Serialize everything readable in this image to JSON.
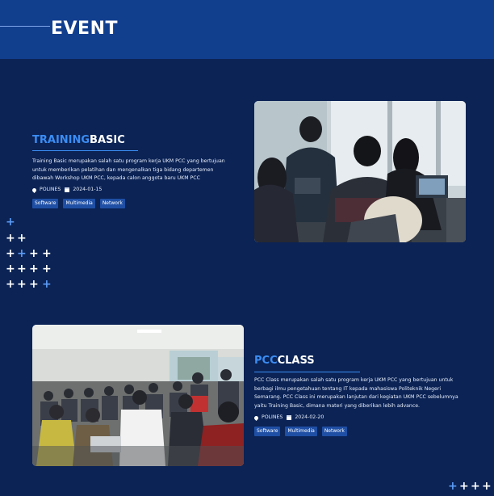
{
  "header": {
    "title": "EVENT"
  },
  "events": [
    {
      "title_accent": "TRAINING",
      "title_rest": "BASIC",
      "description": "Training Basic merupakan salah satu program kerja UKM PCC yang bertujuan untuk memberikan pelatihan dan mengenalkan tiga bidang departemen dibawah Workshop UKM PCC, kepada calon anggota baru UKM PCC",
      "location": "POLINES",
      "date": "2024-01-15",
      "tags": [
        "Software",
        "Multimedia",
        "Network"
      ]
    },
    {
      "title_accent": "PCC",
      "title_rest": "CLASS",
      "description": "PCC Class merupakan salah satu program kerja UKM PCC yang bertujuan untuk berbagi ilmu pengetahuan tentang IT kepada mahasiswa Politeknik Negeri Semarang. PCC Class ini merupakan lanjutan dari kegiatan UKM PCC sebelumnya yaitu Training Basic, dimana materi yang diberikan lebih advance.",
      "location": "POLINES",
      "date": "2024-02-20",
      "tags": [
        "Software",
        "Multimedia",
        "Network"
      ]
    }
  ],
  "colors": {
    "background": "#0b2355",
    "header": "#123e8e",
    "accent": "#3b8df4",
    "tag": "#1f4fa5"
  }
}
